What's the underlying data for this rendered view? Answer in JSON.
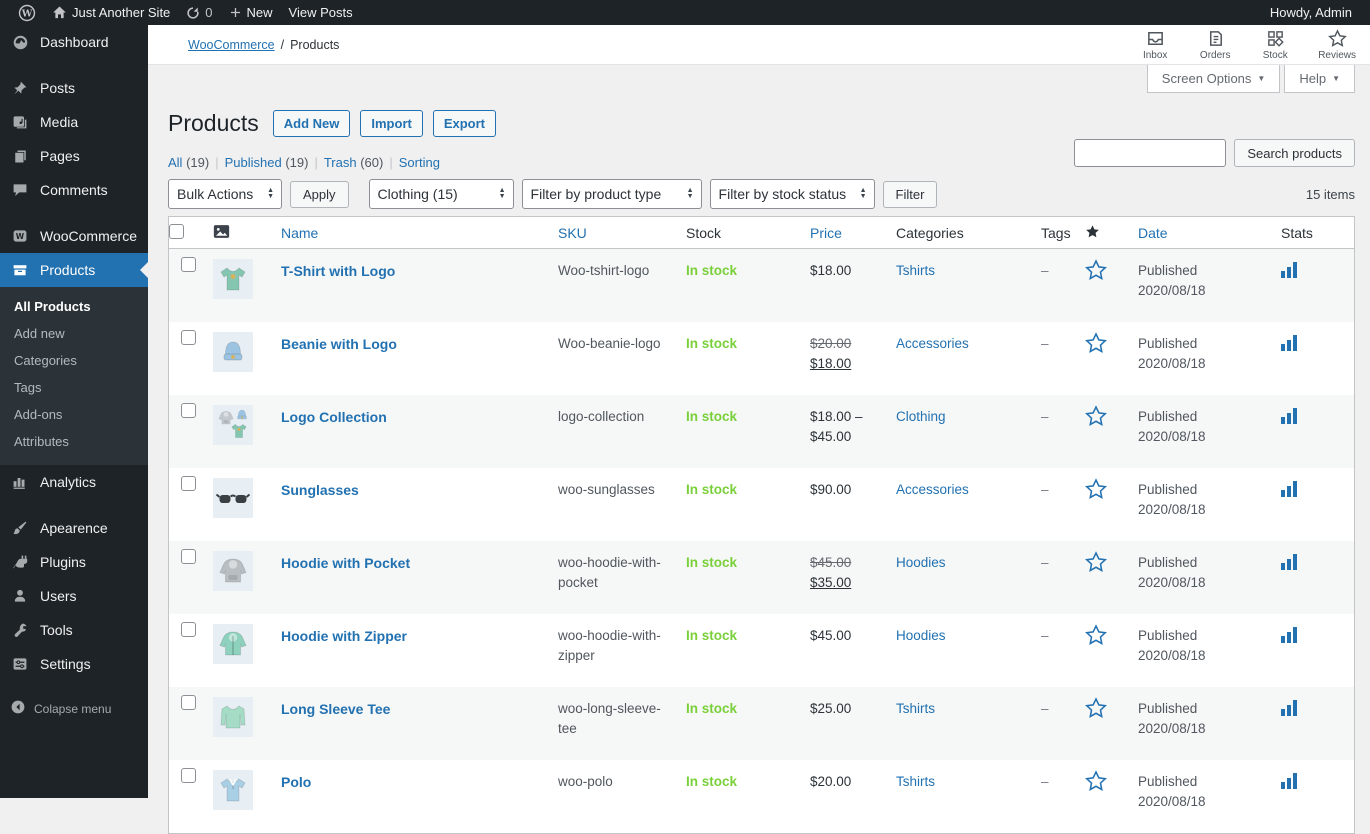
{
  "colors": {
    "accent": "#2271b1",
    "instock_green": "#7ad03a",
    "adminbar_bg": "#1d2327",
    "stripe": "#f6f7f7"
  },
  "admin_bar": {
    "site_name": "Just Another Site",
    "update_count": "0",
    "new_label": "New",
    "view_posts_label": "View Posts",
    "howdy": "Howdy, Admin"
  },
  "sidebar": {
    "items": [
      {
        "label": "Dashboard",
        "icon": "dashboard-icon"
      },
      {
        "label": "Posts",
        "icon": "pin-icon"
      },
      {
        "label": "Media",
        "icon": "media-icon"
      },
      {
        "label": "Pages",
        "icon": "pages-icon"
      },
      {
        "label": "Comments",
        "icon": "comment-icon"
      },
      {
        "label": "WooCommerce",
        "icon": "woocommerce-icon"
      },
      {
        "label": "Products",
        "icon": "products-icon",
        "active": true
      }
    ],
    "submenu": [
      {
        "label": "All Products",
        "current": true
      },
      {
        "label": "Add new"
      },
      {
        "label": "Categories"
      },
      {
        "label": "Tags"
      },
      {
        "label": "Add-ons"
      },
      {
        "label": "Attributes"
      }
    ],
    "lower": [
      {
        "label": "Analytics",
        "icon": "analytics-icon"
      },
      {
        "label": "Apearence",
        "icon": "appearance-icon"
      },
      {
        "label": "Plugins",
        "icon": "plugin-icon"
      },
      {
        "label": "Users",
        "icon": "user-icon"
      },
      {
        "label": "Tools",
        "icon": "tools-icon"
      },
      {
        "label": "Settings",
        "icon": "settings-icon"
      }
    ],
    "collapse_label": "Colapse menu"
  },
  "wc_header": {
    "breadcrumb_link": "WooCommerce",
    "breadcrumb_sep": "/",
    "breadcrumb_current": "Products",
    "activity": [
      {
        "label": "Inbox",
        "icon": "inbox-icon"
      },
      {
        "label": "Orders",
        "icon": "orders-icon"
      },
      {
        "label": "Stock",
        "icon": "stock-icon"
      },
      {
        "label": "Reviews",
        "icon": "reviews-star-icon"
      }
    ],
    "screen_options_label": "Screen Options",
    "help_label": "Help"
  },
  "page": {
    "title": "Products",
    "add_new_label": "Add New",
    "import_label": "Import",
    "export_label": "Export"
  },
  "views": [
    {
      "label": "All",
      "count": "(19)"
    },
    {
      "label": "Published",
      "count": "(19)"
    },
    {
      "label": "Trash",
      "count": "(60)"
    },
    {
      "label": "Sorting",
      "count": ""
    }
  ],
  "filters": {
    "bulk_actions_value": "Bulk Actions",
    "apply_label": "Apply",
    "category_value": "Clothing  (15)",
    "product_type_value": "Filter by product type",
    "stock_status_value": "Filter by stock status",
    "filter_label": "Filter",
    "item_count": "15 items",
    "search_value": "",
    "search_button_label": "Search products"
  },
  "table": {
    "headers": {
      "name": "Name",
      "sku": "SKU",
      "stock": "Stock",
      "price": "Price",
      "categories": "Categories",
      "tags": "Tags",
      "date": "Date",
      "stats": "Stats"
    }
  },
  "products": [
    {
      "name": "T-Shirt with Logo",
      "sku": "Woo-tshirt-logo",
      "stock": "In stock",
      "price_old": "",
      "price_sale": "",
      "price_main": "$18.00",
      "categories": "Tshirts",
      "tags": "–",
      "date_status": "Published",
      "date": "2020/08/18",
      "thumb": "tshirt",
      "thumb_color": "#85c6b1"
    },
    {
      "name": "Beanie with Logo",
      "sku": "Woo-beanie-logo",
      "stock": "In stock",
      "price_old": "$20.00",
      "price_sale": "$18.00",
      "price_main": "",
      "categories": "Accessories",
      "tags": "–",
      "date_status": "Published",
      "date": "2020/08/18",
      "thumb": "beanie",
      "thumb_color": "#9cc4e2"
    },
    {
      "name": "Logo Collection",
      "sku": "logo-collection",
      "stock": "In stock",
      "price_old": "",
      "price_sale": "",
      "price_main": "$18.00 – $45.00",
      "categories": "Clothing",
      "tags": "–",
      "date_status": "Published",
      "date": "2020/08/18",
      "thumb": "collection",
      "thumb_color": "#9cc4e2"
    },
    {
      "name": "Sunglasses",
      "sku": "woo-sunglasses",
      "stock": "In stock",
      "price_old": "",
      "price_sale": "",
      "price_main": "$90.00",
      "categories": "Accessories",
      "tags": "–",
      "date_status": "Published",
      "date": "2020/08/18",
      "thumb": "sunglasses",
      "thumb_color": "#3a3f44"
    },
    {
      "name": "Hoodie with Pocket",
      "sku": "woo-hoodie-with-pocket",
      "stock": "In stock",
      "price_old": "$45.00",
      "price_sale": "$35.00",
      "price_main": "",
      "categories": "Hoodies",
      "tags": "–",
      "date_status": "Published",
      "date": "2020/08/18",
      "thumb": "hoodie-pocket",
      "thumb_color": "#b9bec3"
    },
    {
      "name": "Hoodie with Zipper",
      "sku": "woo-hoodie-with-zipper",
      "stock": "In stock",
      "price_old": "",
      "price_sale": "",
      "price_main": "$45.00",
      "categories": "Hoodies",
      "tags": "–",
      "date_status": "Published",
      "date": "2020/08/18",
      "thumb": "hoodie-zipper",
      "thumb_color": "#8ed1bd"
    },
    {
      "name": "Long Sleeve Tee",
      "sku": "woo-long-sleeve-tee",
      "stock": "In stock",
      "price_old": "",
      "price_sale": "",
      "price_main": "$25.00",
      "categories": "Tshirts",
      "tags": "–",
      "date_status": "Published",
      "date": "2020/08/18",
      "thumb": "longsleeve",
      "thumb_color": "#a5dcc6"
    },
    {
      "name": "Polo",
      "sku": "woo-polo",
      "stock": "In stock",
      "price_old": "",
      "price_sale": "",
      "price_main": "$20.00",
      "categories": "Tshirts",
      "tags": "–",
      "date_status": "Published",
      "date": "2020/08/18",
      "thumb": "polo",
      "thumb_color": "#a9cfe5"
    }
  ]
}
